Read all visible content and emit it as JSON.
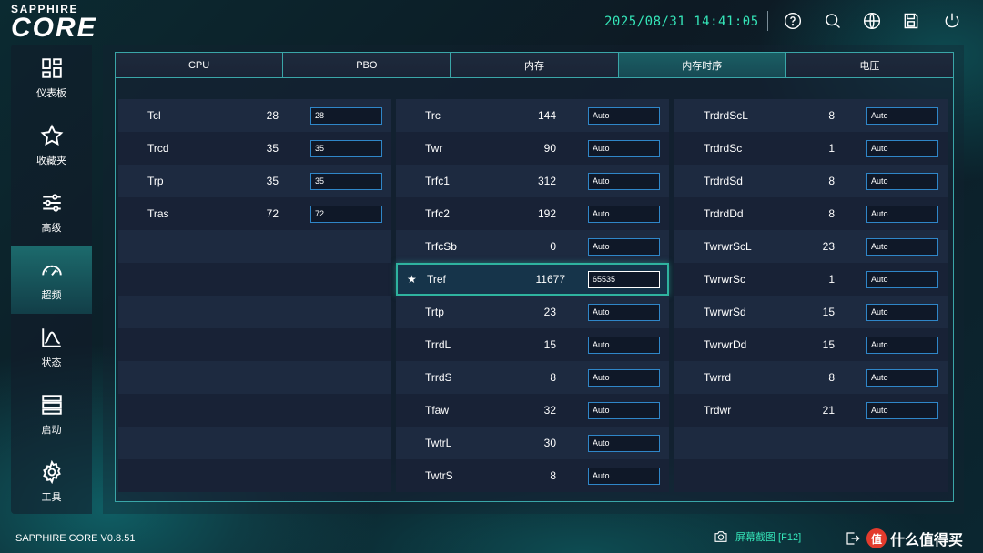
{
  "brand": {
    "top": "SAPPHIRE",
    "core": "CORE"
  },
  "header": {
    "datetime": "2025/08/31 14:41:05",
    "icons": [
      "help-icon",
      "search-icon",
      "globe-icon",
      "save-icon",
      "power-icon"
    ]
  },
  "sidebar": {
    "items": [
      {
        "label": "仪表板",
        "icon": "dashboard-icon"
      },
      {
        "label": "收藏夹",
        "icon": "star-icon"
      },
      {
        "label": "高级",
        "icon": "sliders-icon"
      },
      {
        "label": "超频",
        "icon": "gauge-icon"
      },
      {
        "label": "状态",
        "icon": "chart-icon"
      },
      {
        "label": "启动",
        "icon": "server-icon"
      },
      {
        "label": "工具",
        "icon": "gear-icon"
      }
    ]
  },
  "tabs": [
    "CPU",
    "PBO",
    "内存",
    "内存时序",
    "电压"
  ],
  "columns": {
    "left": [
      {
        "name": "Tcl",
        "value": "28",
        "input": "28"
      },
      {
        "name": "Trcd",
        "value": "35",
        "input": "35"
      },
      {
        "name": "Trp",
        "value": "35",
        "input": "35"
      },
      {
        "name": "Tras",
        "value": "72",
        "input": "72"
      }
    ],
    "middle": [
      {
        "name": "Trc",
        "value": "144",
        "input": "Auto"
      },
      {
        "name": "Twr",
        "value": "90",
        "input": "Auto"
      },
      {
        "name": "Trfc1",
        "value": "312",
        "input": "Auto"
      },
      {
        "name": "Trfc2",
        "value": "192",
        "input": "Auto"
      },
      {
        "name": "TrfcSb",
        "value": "0",
        "input": "Auto"
      },
      {
        "name": "Tref",
        "value": "11677",
        "input": "65535"
      },
      {
        "name": "Trtp",
        "value": "23",
        "input": "Auto"
      },
      {
        "name": "TrrdL",
        "value": "15",
        "input": "Auto"
      },
      {
        "name": "TrrdS",
        "value": "8",
        "input": "Auto"
      },
      {
        "name": "Tfaw",
        "value": "32",
        "input": "Auto"
      },
      {
        "name": "TwtrL",
        "value": "30",
        "input": "Auto"
      },
      {
        "name": "TwtrS",
        "value": "8",
        "input": "Auto"
      }
    ],
    "right": [
      {
        "name": "TrdrdScL",
        "value": "8",
        "input": "Auto"
      },
      {
        "name": "TrdrdSc",
        "value": "1",
        "input": "Auto"
      },
      {
        "name": "TrdrdSd",
        "value": "8",
        "input": "Auto"
      },
      {
        "name": "TrdrdDd",
        "value": "8",
        "input": "Auto"
      },
      {
        "name": "TwrwrScL",
        "value": "23",
        "input": "Auto"
      },
      {
        "name": "TwrwrSc",
        "value": "1",
        "input": "Auto"
      },
      {
        "name": "TwrwrSd",
        "value": "15",
        "input": "Auto"
      },
      {
        "name": "TwrwrDd",
        "value": "15",
        "input": "Auto"
      },
      {
        "name": "Twrrd",
        "value": "8",
        "input": "Auto"
      },
      {
        "name": "Trdwr",
        "value": "21",
        "input": "Auto"
      }
    ]
  },
  "footer": {
    "version": "SAPPHIRE CORE V0.8.51",
    "screenshot_label": "屏幕截图 [F12]",
    "watermark_badge": "值",
    "watermark_text": "什么值得买"
  }
}
